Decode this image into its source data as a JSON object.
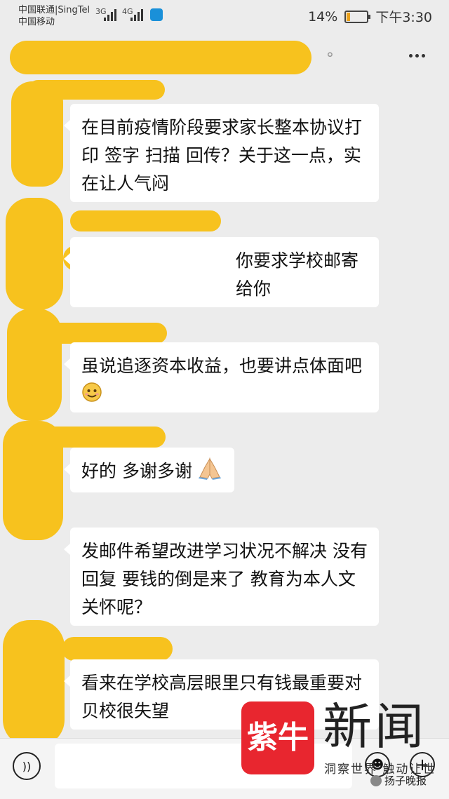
{
  "status_bar": {
    "carrier_1": "中国联通|SingTel",
    "carrier_2": "中国移动",
    "signal_1": "3G",
    "signal_2": "4G",
    "battery": "14%",
    "time": "下午3:30"
  },
  "messages": [
    {
      "text": "在目前疫情阶段要求家长整本协议打印 签字 扫描 回传？关于这一点，实在让人气闷"
    },
    {
      "text": "你要求学校邮寄给你"
    },
    {
      "text": "虽说追逐资本收益，也要讲点体面吧"
    },
    {
      "text": "好的 多谢多谢"
    },
    {
      "text": "发邮件希望改进学习状况不解决 没有回复 要钱的倒是来了 教育为本人文关怀呢？"
    },
    {
      "text": "看来在学校高层眼里只有钱最重要对贝校很失望"
    }
  ],
  "icons": {
    "ear": "ear-icon",
    "more": "more-icon",
    "voice": "voice-icon",
    "emoji": "emoji-icon",
    "plus": "plus-icon"
  },
  "watermark": {
    "logo_text": "紫牛",
    "title": "新闻",
    "slogan": "洞察世界 触动让世",
    "source": "扬子晚报"
  },
  "colors": {
    "redaction": "#f7c21e",
    "logo": "#e8262f"
  }
}
